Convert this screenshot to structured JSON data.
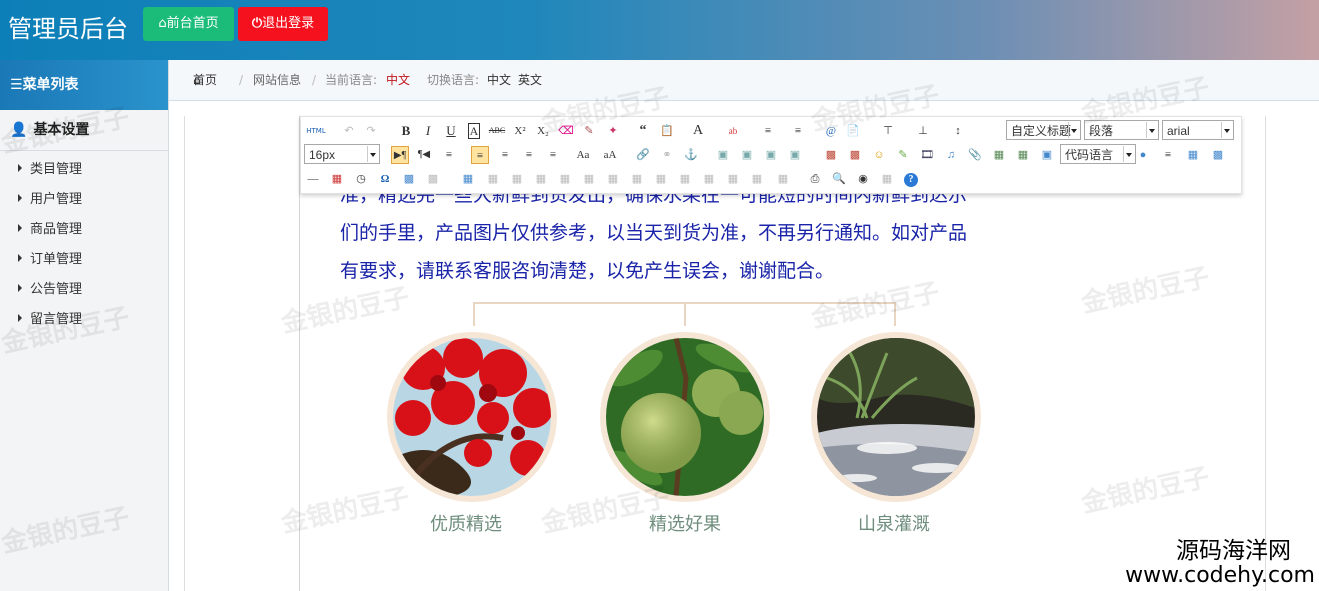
{
  "header": {
    "title": "管理员后台",
    "home_btn": "前台首页",
    "logout_btn": "退出登录"
  },
  "sidebar": {
    "menu_title": "菜单列表",
    "group_title": "基本设置",
    "items": [
      {
        "label": "类目管理"
      },
      {
        "label": "用户管理"
      },
      {
        "label": "商品管理"
      },
      {
        "label": "订单管理"
      },
      {
        "label": "公告管理"
      },
      {
        "label": "留言管理"
      }
    ]
  },
  "breadcrumb": {
    "home": "首页",
    "page": "网站信息",
    "current_lang_label": "当前语言:",
    "current_lang": "中文",
    "switch_label": "切换语言:",
    "lang_zh": "中文",
    "lang_en": "英文"
  },
  "toolbar": {
    "html_label": "HTML",
    "custom_title": "自定义标题",
    "paragraph": "段落",
    "font_family": "arial",
    "font_size": "16px",
    "code_lang": "代码语言"
  },
  "content": {
    "line1": "准，精选完一些大新鲜到货发出，确保水果在一可能短的时间内新鲜到达示",
    "line2": "们的手里，产品图片仅供参考，以当天到货为准，不再另行通知。如对产品",
    "line3": "有要求，请联系客服咨询清楚，以免产生误会，谢谢配合。"
  },
  "features": [
    {
      "caption": "优质精选",
      "image": "red-blossom-tree"
    },
    {
      "caption": "精选好果",
      "image": "green-pomegranate"
    },
    {
      "caption": "山泉灌溉",
      "image": "mountain-stream"
    }
  ],
  "watermark": "金银的豆子",
  "brand": {
    "name": "源码海洋网",
    "url": "www.codehy.com"
  },
  "colors": {
    "home_btn": "#1bbc7a",
    "logout_btn": "#f5121e",
    "content_text": "#1a24a8",
    "caption_text": "#6f8e7e"
  }
}
